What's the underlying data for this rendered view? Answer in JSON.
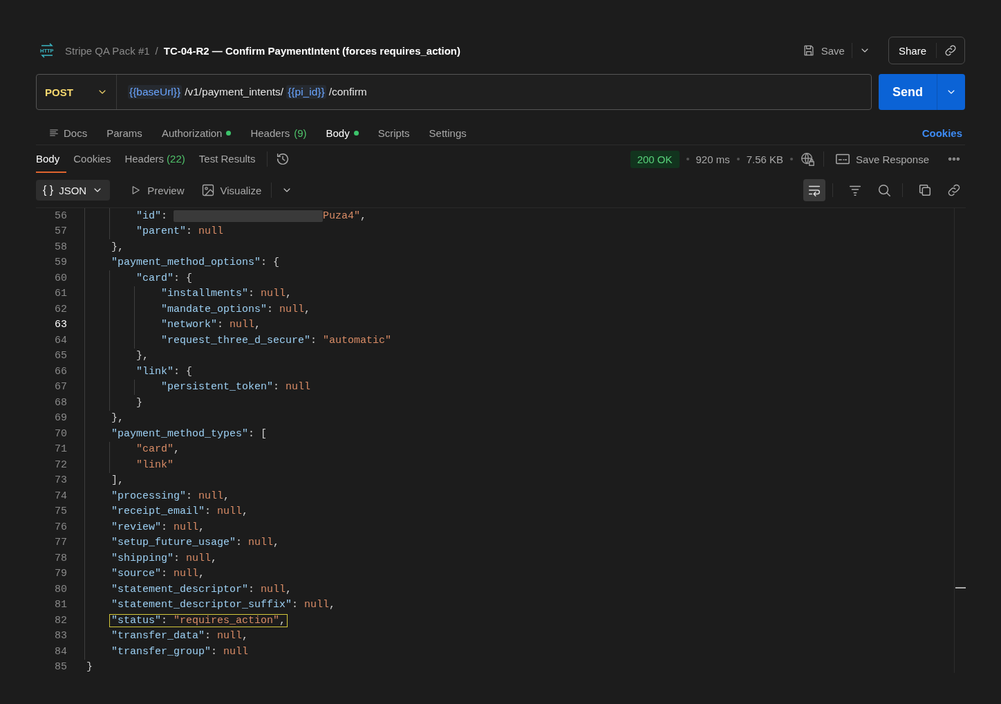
{
  "header": {
    "icon_text": "HTTP",
    "collection": "Stripe QA Pack #1",
    "separator": "/",
    "title": "TC-04-R2 — Confirm PaymentIntent (forces requires_action)",
    "save": "Save",
    "share": "Share"
  },
  "request": {
    "method": "POST",
    "url": [
      {
        "kind": "variable",
        "text": "{{baseUrl}}"
      },
      {
        "kind": "path",
        "text": "/v1/payment_intents/"
      },
      {
        "kind": "variable",
        "text": "{{pi_id}}"
      },
      {
        "kind": "path",
        "text": "/confirm"
      }
    ],
    "send": "Send"
  },
  "request_tabs": [
    {
      "label": "Docs",
      "selected": false,
      "dot": false
    },
    {
      "label": "Params",
      "selected": false,
      "dot": false
    },
    {
      "label": "Authorization",
      "selected": false,
      "dot": true
    },
    {
      "label": "Headers",
      "count": "(9)",
      "selected": false,
      "dot": false
    },
    {
      "label": "Body",
      "selected": true,
      "dot": true
    },
    {
      "label": "Scripts",
      "selected": false,
      "dot": false
    },
    {
      "label": "Settings",
      "selected": false,
      "dot": false
    }
  ],
  "cookies_link": "Cookies",
  "response_tabs": [
    {
      "label": "Body",
      "selected": true
    },
    {
      "label": "Cookies",
      "selected": false
    },
    {
      "label": "Headers",
      "count": "(22)",
      "selected": false
    },
    {
      "label": "Test Results",
      "selected": false
    }
  ],
  "response_status": {
    "status": "200 OK",
    "time": "920 ms",
    "size": "7.56 KB",
    "save_response": "Save Response"
  },
  "view_bar": {
    "format_icon": "{ }",
    "format": "JSON",
    "preview": "Preview",
    "visualize": "Visualize",
    "wrap_on": true
  },
  "editor": {
    "lines": [
      {
        "children": [
          {
            "children": [
              {
                "number": "56",
                "current": false,
                "highlighted": false,
                "tokens": [
                  {
                    "kind": "key",
                    "text": "\"id\""
                  },
                  {
                    "kind": "punct",
                    "text": ": "
                  },
                  {
                    "kind": "redacted"
                  },
                  {
                    "kind": "string",
                    "text": "Puza4\""
                  },
                  {
                    "kind": "punct",
                    "text": ","
                  }
                ]
              },
              {
                "number": "57",
                "current": false,
                "highlighted": false,
                "tokens": [
                  {
                    "kind": "key",
                    "text": "\"parent\""
                  },
                  {
                    "kind": "punct",
                    "text": ": "
                  },
                  {
                    "kind": "null",
                    "text": "null"
                  }
                ]
              }
            ]
          },
          {
            "number": "58",
            "current": false,
            "highlighted": false,
            "tokens": [
              {
                "kind": "punct",
                "text": "},"
              }
            ]
          },
          {
            "number": "59",
            "current": false,
            "highlighted": false,
            "tokens": [
              {
                "kind": "key",
                "text": "\"payment_method_options\""
              },
              {
                "kind": "punct",
                "text": ": {"
              }
            ],
            "children": [
              {
                "number": "60",
                "current": false,
                "highlighted": false,
                "tokens": [
                  {
                    "kind": "key",
                    "text": "\"card\""
                  },
                  {
                    "kind": "punct",
                    "text": ": {"
                  }
                ],
                "children": [
                  {
                    "number": "61",
                    "current": false,
                    "highlighted": false,
                    "tokens": [
                      {
                        "kind": "key",
                        "text": "\"installments\""
                      },
                      {
                        "kind": "punct",
                        "text": ": "
                      },
                      {
                        "kind": "null",
                        "text": "null"
                      },
                      {
                        "kind": "punct",
                        "text": ","
                      }
                    ]
                  },
                  {
                    "number": "62",
                    "current": false,
                    "highlighted": false,
                    "tokens": [
                      {
                        "kind": "key",
                        "text": "\"mandate_options\""
                      },
                      {
                        "kind": "punct",
                        "text": ": "
                      },
                      {
                        "kind": "null",
                        "text": "null"
                      },
                      {
                        "kind": "punct",
                        "text": ","
                      }
                    ]
                  },
                  {
                    "number": "63",
                    "current": true,
                    "highlighted": false,
                    "tokens": [
                      {
                        "kind": "key",
                        "text": "\"network\""
                      },
                      {
                        "kind": "punct",
                        "text": ": "
                      },
                      {
                        "kind": "null",
                        "text": "null"
                      },
                      {
                        "kind": "punct",
                        "text": ","
                      }
                    ]
                  },
                  {
                    "number": "64",
                    "current": false,
                    "highlighted": false,
                    "tokens": [
                      {
                        "kind": "key",
                        "text": "\"request_three_d_secure\""
                      },
                      {
                        "kind": "punct",
                        "text": ": "
                      },
                      {
                        "kind": "string",
                        "text": "\"automatic\""
                      }
                    ]
                  }
                ]
              },
              {
                "number": "65",
                "current": false,
                "highlighted": false,
                "tokens": [
                  {
                    "kind": "punct",
                    "text": "},"
                  }
                ]
              },
              {
                "number": "66",
                "current": false,
                "highlighted": false,
                "tokens": [
                  {
                    "kind": "key",
                    "text": "\"link\""
                  },
                  {
                    "kind": "punct",
                    "text": ": {"
                  }
                ],
                "children": [
                  {
                    "number": "67",
                    "current": false,
                    "highlighted": false,
                    "tokens": [
                      {
                        "kind": "key",
                        "text": "\"persistent_token\""
                      },
                      {
                        "kind": "punct",
                        "text": ": "
                      },
                      {
                        "kind": "null",
                        "text": "null"
                      }
                    ]
                  }
                ]
              },
              {
                "number": "68",
                "current": false,
                "highlighted": false,
                "tokens": [
                  {
                    "kind": "punct",
                    "text": "}"
                  }
                ]
              }
            ]
          },
          {
            "number": "69",
            "current": false,
            "highlighted": false,
            "tokens": [
              {
                "kind": "punct",
                "text": "},"
              }
            ]
          },
          {
            "number": "70",
            "current": false,
            "highlighted": false,
            "tokens": [
              {
                "kind": "key",
                "text": "\"payment_method_types\""
              },
              {
                "kind": "punct",
                "text": ": ["
              }
            ],
            "children": [
              {
                "number": "71",
                "current": false,
                "highlighted": false,
                "tokens": [
                  {
                    "kind": "string",
                    "text": "\"card\""
                  },
                  {
                    "kind": "punct",
                    "text": ","
                  }
                ]
              },
              {
                "number": "72",
                "current": false,
                "highlighted": false,
                "tokens": [
                  {
                    "kind": "string",
                    "text": "\"link\""
                  }
                ]
              }
            ]
          },
          {
            "number": "73",
            "current": false,
            "highlighted": false,
            "tokens": [
              {
                "kind": "punct",
                "text": "],"
              }
            ]
          },
          {
            "number": "74",
            "current": false,
            "highlighted": false,
            "tokens": [
              {
                "kind": "key",
                "text": "\"processing\""
              },
              {
                "kind": "punct",
                "text": ": "
              },
              {
                "kind": "null",
                "text": "null"
              },
              {
                "kind": "punct",
                "text": ","
              }
            ]
          },
          {
            "number": "75",
            "current": false,
            "highlighted": false,
            "tokens": [
              {
                "kind": "key",
                "text": "\"receipt_email\""
              },
              {
                "kind": "punct",
                "text": ": "
              },
              {
                "kind": "null",
                "text": "null"
              },
              {
                "kind": "punct",
                "text": ","
              }
            ]
          },
          {
            "number": "76",
            "current": false,
            "highlighted": false,
            "tokens": [
              {
                "kind": "key",
                "text": "\"review\""
              },
              {
                "kind": "punct",
                "text": ": "
              },
              {
                "kind": "null",
                "text": "null"
              },
              {
                "kind": "punct",
                "text": ","
              }
            ]
          },
          {
            "number": "77",
            "current": false,
            "highlighted": false,
            "tokens": [
              {
                "kind": "key",
                "text": "\"setup_future_usage\""
              },
              {
                "kind": "punct",
                "text": ": "
              },
              {
                "kind": "null",
                "text": "null"
              },
              {
                "kind": "punct",
                "text": ","
              }
            ]
          },
          {
            "number": "78",
            "current": false,
            "highlighted": false,
            "tokens": [
              {
                "kind": "key",
                "text": "\"shipping\""
              },
              {
                "kind": "punct",
                "text": ": "
              },
              {
                "kind": "null",
                "text": "null"
              },
              {
                "kind": "punct",
                "text": ","
              }
            ]
          },
          {
            "number": "79",
            "current": false,
            "highlighted": false,
            "tokens": [
              {
                "kind": "key",
                "text": "\"source\""
              },
              {
                "kind": "punct",
                "text": ": "
              },
              {
                "kind": "null",
                "text": "null"
              },
              {
                "kind": "punct",
                "text": ","
              }
            ]
          },
          {
            "number": "80",
            "current": false,
            "highlighted": false,
            "tokens": [
              {
                "kind": "key",
                "text": "\"statement_descriptor\""
              },
              {
                "kind": "punct",
                "text": ": "
              },
              {
                "kind": "null",
                "text": "null"
              },
              {
                "kind": "punct",
                "text": ","
              }
            ]
          },
          {
            "number": "81",
            "current": false,
            "highlighted": false,
            "tokens": [
              {
                "kind": "key",
                "text": "\"statement_descriptor_suffix\""
              },
              {
                "kind": "punct",
                "text": ": "
              },
              {
                "kind": "null",
                "text": "null"
              },
              {
                "kind": "punct",
                "text": ","
              }
            ]
          },
          {
            "number": "82",
            "current": false,
            "highlighted": true,
            "tokens": [
              {
                "kind": "key",
                "text": "\"status\""
              },
              {
                "kind": "punct",
                "text": ": "
              },
              {
                "kind": "string",
                "text": "\"requires_action\""
              },
              {
                "kind": "punct",
                "text": ","
              }
            ]
          },
          {
            "number": "83",
            "current": false,
            "highlighted": false,
            "tokens": [
              {
                "kind": "key",
                "text": "\"transfer_data\""
              },
              {
                "kind": "punct",
                "text": ": "
              },
              {
                "kind": "null",
                "text": "null"
              },
              {
                "kind": "punct",
                "text": ","
              }
            ]
          },
          {
            "number": "84",
            "current": false,
            "highlighted": false,
            "tokens": [
              {
                "kind": "key",
                "text": "\"transfer_group\""
              },
              {
                "kind": "punct",
                "text": ": "
              },
              {
                "kind": "null",
                "text": "null"
              }
            ]
          }
        ]
      },
      {
        "number": "85",
        "current": false,
        "highlighted": false,
        "tokens": [
          {
            "kind": "punct",
            "text": "}"
          }
        ]
      }
    ]
  }
}
